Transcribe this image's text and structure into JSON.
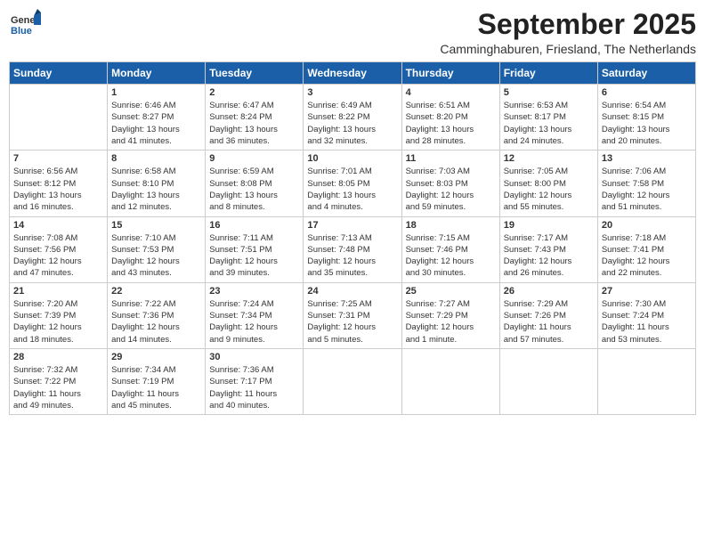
{
  "header": {
    "logo_general": "General",
    "logo_blue": "Blue",
    "month_title": "September 2025",
    "subtitle": "Camminghaburen, Friesland, The Netherlands"
  },
  "weekdays": [
    "Sunday",
    "Monday",
    "Tuesday",
    "Wednesday",
    "Thursday",
    "Friday",
    "Saturday"
  ],
  "weeks": [
    [
      {
        "day": "",
        "content": ""
      },
      {
        "day": "1",
        "content": "Sunrise: 6:46 AM\nSunset: 8:27 PM\nDaylight: 13 hours\nand 41 minutes."
      },
      {
        "day": "2",
        "content": "Sunrise: 6:47 AM\nSunset: 8:24 PM\nDaylight: 13 hours\nand 36 minutes."
      },
      {
        "day": "3",
        "content": "Sunrise: 6:49 AM\nSunset: 8:22 PM\nDaylight: 13 hours\nand 32 minutes."
      },
      {
        "day": "4",
        "content": "Sunrise: 6:51 AM\nSunset: 8:20 PM\nDaylight: 13 hours\nand 28 minutes."
      },
      {
        "day": "5",
        "content": "Sunrise: 6:53 AM\nSunset: 8:17 PM\nDaylight: 13 hours\nand 24 minutes."
      },
      {
        "day": "6",
        "content": "Sunrise: 6:54 AM\nSunset: 8:15 PM\nDaylight: 13 hours\nand 20 minutes."
      }
    ],
    [
      {
        "day": "7",
        "content": "Sunrise: 6:56 AM\nSunset: 8:12 PM\nDaylight: 13 hours\nand 16 minutes."
      },
      {
        "day": "8",
        "content": "Sunrise: 6:58 AM\nSunset: 8:10 PM\nDaylight: 13 hours\nand 12 minutes."
      },
      {
        "day": "9",
        "content": "Sunrise: 6:59 AM\nSunset: 8:08 PM\nDaylight: 13 hours\nand 8 minutes."
      },
      {
        "day": "10",
        "content": "Sunrise: 7:01 AM\nSunset: 8:05 PM\nDaylight: 13 hours\nand 4 minutes."
      },
      {
        "day": "11",
        "content": "Sunrise: 7:03 AM\nSunset: 8:03 PM\nDaylight: 12 hours\nand 59 minutes."
      },
      {
        "day": "12",
        "content": "Sunrise: 7:05 AM\nSunset: 8:00 PM\nDaylight: 12 hours\nand 55 minutes."
      },
      {
        "day": "13",
        "content": "Sunrise: 7:06 AM\nSunset: 7:58 PM\nDaylight: 12 hours\nand 51 minutes."
      }
    ],
    [
      {
        "day": "14",
        "content": "Sunrise: 7:08 AM\nSunset: 7:56 PM\nDaylight: 12 hours\nand 47 minutes."
      },
      {
        "day": "15",
        "content": "Sunrise: 7:10 AM\nSunset: 7:53 PM\nDaylight: 12 hours\nand 43 minutes."
      },
      {
        "day": "16",
        "content": "Sunrise: 7:11 AM\nSunset: 7:51 PM\nDaylight: 12 hours\nand 39 minutes."
      },
      {
        "day": "17",
        "content": "Sunrise: 7:13 AM\nSunset: 7:48 PM\nDaylight: 12 hours\nand 35 minutes."
      },
      {
        "day": "18",
        "content": "Sunrise: 7:15 AM\nSunset: 7:46 PM\nDaylight: 12 hours\nand 30 minutes."
      },
      {
        "day": "19",
        "content": "Sunrise: 7:17 AM\nSunset: 7:43 PM\nDaylight: 12 hours\nand 26 minutes."
      },
      {
        "day": "20",
        "content": "Sunrise: 7:18 AM\nSunset: 7:41 PM\nDaylight: 12 hours\nand 22 minutes."
      }
    ],
    [
      {
        "day": "21",
        "content": "Sunrise: 7:20 AM\nSunset: 7:39 PM\nDaylight: 12 hours\nand 18 minutes."
      },
      {
        "day": "22",
        "content": "Sunrise: 7:22 AM\nSunset: 7:36 PM\nDaylight: 12 hours\nand 14 minutes."
      },
      {
        "day": "23",
        "content": "Sunrise: 7:24 AM\nSunset: 7:34 PM\nDaylight: 12 hours\nand 9 minutes."
      },
      {
        "day": "24",
        "content": "Sunrise: 7:25 AM\nSunset: 7:31 PM\nDaylight: 12 hours\nand 5 minutes."
      },
      {
        "day": "25",
        "content": "Sunrise: 7:27 AM\nSunset: 7:29 PM\nDaylight: 12 hours\nand 1 minute."
      },
      {
        "day": "26",
        "content": "Sunrise: 7:29 AM\nSunset: 7:26 PM\nDaylight: 11 hours\nand 57 minutes."
      },
      {
        "day": "27",
        "content": "Sunrise: 7:30 AM\nSunset: 7:24 PM\nDaylight: 11 hours\nand 53 minutes."
      }
    ],
    [
      {
        "day": "28",
        "content": "Sunrise: 7:32 AM\nSunset: 7:22 PM\nDaylight: 11 hours\nand 49 minutes."
      },
      {
        "day": "29",
        "content": "Sunrise: 7:34 AM\nSunset: 7:19 PM\nDaylight: 11 hours\nand 45 minutes."
      },
      {
        "day": "30",
        "content": "Sunrise: 7:36 AM\nSunset: 7:17 PM\nDaylight: 11 hours\nand 40 minutes."
      },
      {
        "day": "",
        "content": ""
      },
      {
        "day": "",
        "content": ""
      },
      {
        "day": "",
        "content": ""
      },
      {
        "day": "",
        "content": ""
      }
    ]
  ]
}
